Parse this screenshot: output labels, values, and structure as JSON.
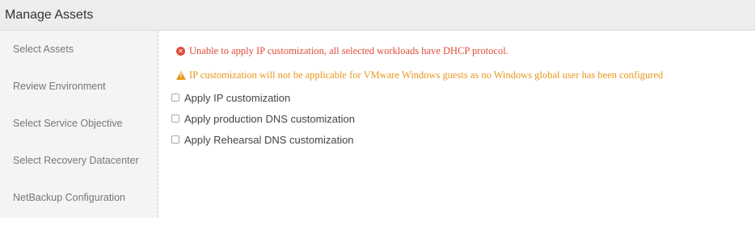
{
  "header": {
    "title": "Manage Assets"
  },
  "sidebar": {
    "items": [
      {
        "label": "Select Assets"
      },
      {
        "label": "Review Environment"
      },
      {
        "label": "Select Service Objective"
      },
      {
        "label": "Select Recovery Datacenter"
      },
      {
        "label": "NetBackup Configuration"
      }
    ]
  },
  "main": {
    "error_message": "Unable to apply IP customization, all selected workloads have DHCP protocol.",
    "warning_message": "IP customization will not be applicable for VMware Windows guests as no Windows global user has been configured",
    "options": [
      {
        "label": "Apply IP customization",
        "checked": false
      },
      {
        "label": "Apply production DNS customization",
        "checked": false
      },
      {
        "label": "Apply Rehearsal DNS customization",
        "checked": false
      }
    ]
  },
  "colors": {
    "error": "#e24b3a",
    "warning": "#e8971c",
    "header_bg": "#ededed",
    "sidebar_bg": "#f4f4f4"
  },
  "icons": {
    "error": "error-circle-icon",
    "warning": "warning-triangle-icon"
  }
}
